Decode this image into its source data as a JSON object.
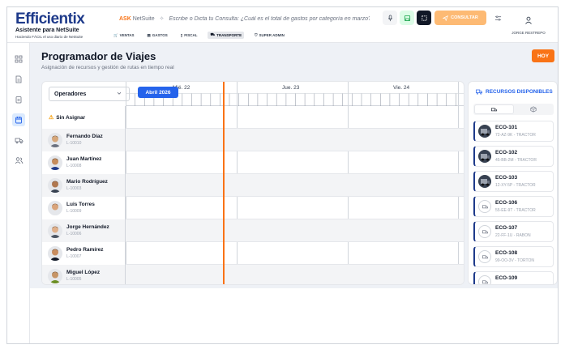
{
  "header": {
    "logo": "Efficientix",
    "logo_sub": "Asistente para NetSuite",
    "logo_sub2": "Haciendo FÁCIL el uso diario de NetSuite",
    "ask_brand": "ASK",
    "ask_brand_2": "NetSuite",
    "ask_placeholder": "Escribe o Dicta tu Consulta: ¿Cuál es el total de gastos por categoría en marzo?",
    "consultar_label": "CONSULTAR",
    "nav": [
      {
        "label": "VENTAS",
        "icon": "cart-icon"
      },
      {
        "label": "GASTOS",
        "icon": "receipt-icon"
      },
      {
        "label": "FISCAL",
        "icon": "document-icon"
      },
      {
        "label": "TRANSPORTE",
        "icon": "truck-icon",
        "active": true
      },
      {
        "label": "SUPER ADMIN",
        "icon": "shield-icon"
      }
    ],
    "user_name": "JORGE RESTREPO"
  },
  "page": {
    "title": "Programador de Viajes",
    "subtitle": "Asignación de recursos y gestión de rutas en tiempo real",
    "today_button": "HOY"
  },
  "scheduler": {
    "filter_label": "Operadores",
    "month_label": "Abril 2026",
    "days": [
      "Mié. 22",
      "Jue. 23",
      "Vie. 24"
    ],
    "unassigned_label": "Sin Asignar",
    "operators": [
      {
        "name": "Fernando Díaz",
        "code": "L-10010",
        "skin": "#d6a77a",
        "hair": "#2b2b2b",
        "shirt": "#6b7280"
      },
      {
        "name": "Juan Martínez",
        "code": "L-10008",
        "skin": "#c58c5c",
        "hair": "#1f1f1f",
        "shirt": "#1e3a8a"
      },
      {
        "name": "Mario Rodríguez",
        "code": "L-10003",
        "skin": "#b07850",
        "hair": "#3a2a1a",
        "shirt": "#374151"
      },
      {
        "name": "Luis Torres",
        "code": "L-10009",
        "skin": "#d9a47a",
        "hair": "#4a3423",
        "shirt": "#e5e7eb"
      },
      {
        "name": "Jorge Hernández",
        "code": "L-10006",
        "skin": "#e0b08a",
        "hair": "#2a1d12",
        "shirt": "#4b5563"
      },
      {
        "name": "Pedro Ramírez",
        "code": "L-10007",
        "skin": "#c88d60",
        "hair": "#1f1f1f",
        "shirt": "#111827"
      },
      {
        "name": "Miguel López",
        "code": "L-10005",
        "skin": "#c69466",
        "hair": "#3b2b1b",
        "shirt": "#6b8e23"
      }
    ]
  },
  "resources": {
    "title": "RECURSOS DISPONIBLES",
    "items": [
      {
        "code": "ECO-101",
        "desc": "72-AZ-9K - TRACTOR",
        "photo": true
      },
      {
        "code": "ECO-102",
        "desc": "45-BB-2M - TRACTOR",
        "photo": true
      },
      {
        "code": "ECO-103",
        "desc": "12-XY-5P - TRACTOR",
        "photo": true
      },
      {
        "code": "ECO-106",
        "desc": "55-EE-9T - TRACTOR",
        "photo": false
      },
      {
        "code": "ECO-107",
        "desc": "22-FF-1U - RABON",
        "photo": false
      },
      {
        "code": "ECO-108",
        "desc": "99-OO-3V - TORTON",
        "photo": false
      },
      {
        "code": "ECO-109",
        "desc": "",
        "photo": false
      }
    ]
  },
  "colors": {
    "brand": "#1e3a8a",
    "accent": "#f97316",
    "primary": "#2563eb"
  }
}
